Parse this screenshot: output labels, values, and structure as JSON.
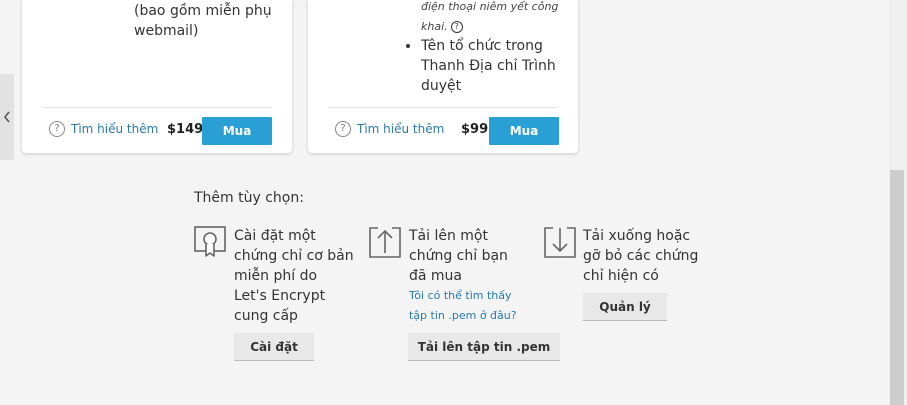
{
  "card1": {
    "feature_text_1": "(bao gồm miễn phụ",
    "feature_text_2": "webmail)",
    "learn_more": "Tìm hiểu thêm",
    "price": "$149",
    "buy_label": "Mua"
  },
  "card2": {
    "note_line_1": "điện thoại niêm yết công",
    "note_line_2": "khai.",
    "bullet_line_1": "Tên tổ chức trong",
    "bullet_line_2": "Thanh Địa chỉ Trình",
    "bullet_line_3": "duyệt",
    "learn_more": "Tìm hiểu thêm",
    "price": "$99",
    "buy_label": "Mua"
  },
  "options": {
    "title": "Thêm tùy chọn:",
    "install": {
      "lines": [
        "Cài đặt một",
        "chứng chỉ cơ bản",
        "miễn phí do",
        "Let's Encrypt",
        "cung cấp"
      ],
      "button": "Cài đặt",
      "icon": "certificate-icon"
    },
    "upload": {
      "lines": [
        "Tải lên một",
        "chứng chỉ bạn",
        "đã mua"
      ],
      "link_lines": [
        "Tôi có thể tìm thấy",
        "tập tin .pem ở đâu?"
      ],
      "button": "Tải lên tập tin .pem",
      "icon": "upload-icon"
    },
    "download": {
      "lines": [
        "Tải xuống hoặc",
        "gỡ bỏ các chứng",
        "chỉ hiện có"
      ],
      "button": "Quản lý",
      "icon": "download-icon"
    }
  },
  "colors": {
    "buy_button": "#2a9fd6",
    "link": "#2a7ab0",
    "background": "#f4f4f4"
  }
}
